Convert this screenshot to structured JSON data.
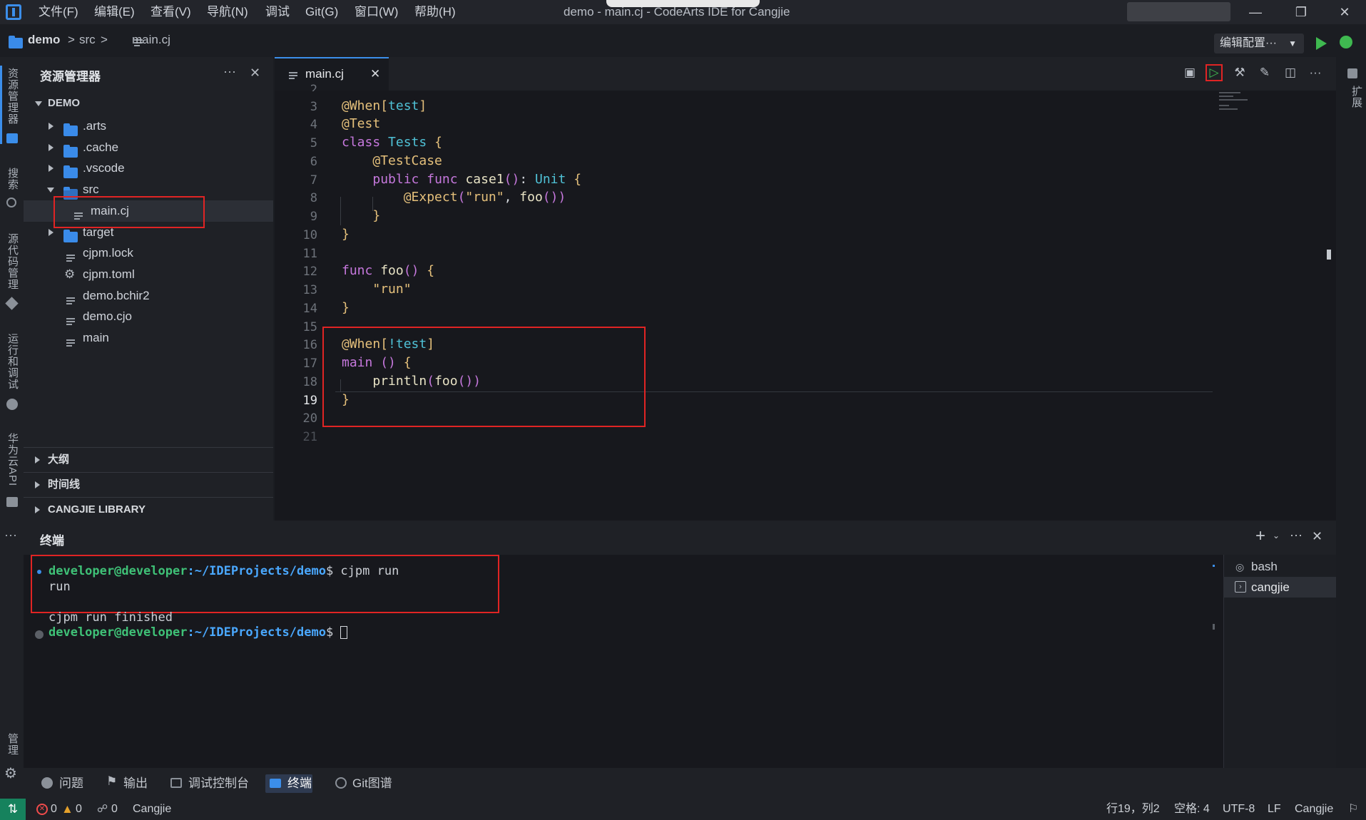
{
  "window": {
    "title": "demo - main.cj - CodeArts IDE for Cangjie",
    "menu": [
      "文件(F)",
      "编辑(E)",
      "查看(V)",
      "导航(N)",
      "调试",
      "Git(G)",
      "窗口(W)",
      "帮助(H)"
    ]
  },
  "breadcrumb": {
    "project": "demo",
    "folder": "src",
    "file": "main.cj",
    "sep": ">"
  },
  "toolbar": {
    "edit_config": "编辑配置···"
  },
  "activity": {
    "explorer": "资源管理器",
    "search": "搜索",
    "scm": "源代码管理",
    "run": "运行和调试",
    "api": "华为云API",
    "manage": "管理",
    "extensions": "扩展"
  },
  "sidebar": {
    "title": "资源管理器",
    "root": "DEMO",
    "items": [
      {
        "label": ".arts",
        "kind": "folder"
      },
      {
        "label": ".cache",
        "kind": "folder"
      },
      {
        "label": ".vscode",
        "kind": "folder"
      },
      {
        "label": "src",
        "kind": "folder-open"
      },
      {
        "label": "main.cj",
        "kind": "file"
      },
      {
        "label": "target",
        "kind": "folder"
      },
      {
        "label": "cjpm.lock",
        "kind": "file"
      },
      {
        "label": "cjpm.toml",
        "kind": "gear-file"
      },
      {
        "label": "demo.bchir2",
        "kind": "file"
      },
      {
        "label": "demo.cjo",
        "kind": "file"
      },
      {
        "label": "main",
        "kind": "file"
      }
    ],
    "sections": [
      "大纲",
      "时间线",
      "CANGJIE LIBRARY"
    ]
  },
  "editor": {
    "tab": "main.cj",
    "lines": [
      {
        "n": "2",
        "code": ""
      },
      {
        "n": "3",
        "code": "@When[test]"
      },
      {
        "n": "4",
        "code": "@Test"
      },
      {
        "n": "5",
        "code": "class Tests {"
      },
      {
        "n": "6",
        "code": "    @TestCase"
      },
      {
        "n": "7",
        "code": "    public func case1(): Unit {"
      },
      {
        "n": "8",
        "code": "        @Expect(\"run\", foo())"
      },
      {
        "n": "9",
        "code": "    }"
      },
      {
        "n": "10",
        "code": "}"
      },
      {
        "n": "11",
        "code": ""
      },
      {
        "n": "12",
        "code": "func foo() {"
      },
      {
        "n": "13",
        "code": "    \"run\""
      },
      {
        "n": "14",
        "code": "}"
      },
      {
        "n": "15",
        "code": ""
      },
      {
        "n": "16",
        "code": "@When[!test]"
      },
      {
        "n": "17",
        "code": "main () {"
      },
      {
        "n": "18",
        "code": "    println(foo())"
      },
      {
        "n": "19",
        "code": "}"
      },
      {
        "n": "20",
        "code": ""
      },
      {
        "n": "21",
        "code": ""
      }
    ]
  },
  "panel": {
    "title": "终端",
    "prompt_user": "developer@developer",
    "prompt_path": ":~/IDEProjects/demo",
    "prompt_sign": "$",
    "command": " cjpm run",
    "output1": "run",
    "output2": "cjpm run finished",
    "terminals": [
      "bash",
      "cangjie"
    ]
  },
  "bottom_tabs": [
    "问题",
    "输出",
    "调试控制台",
    "终端",
    "Git图谱"
  ],
  "status": {
    "errors": "0",
    "warnings": "0",
    "ports": "0",
    "language": "Cangjie",
    "position": "行19，列2",
    "indent": "空格: 4",
    "encoding": "UTF-8",
    "eol": "LF",
    "mode": "Cangjie"
  }
}
